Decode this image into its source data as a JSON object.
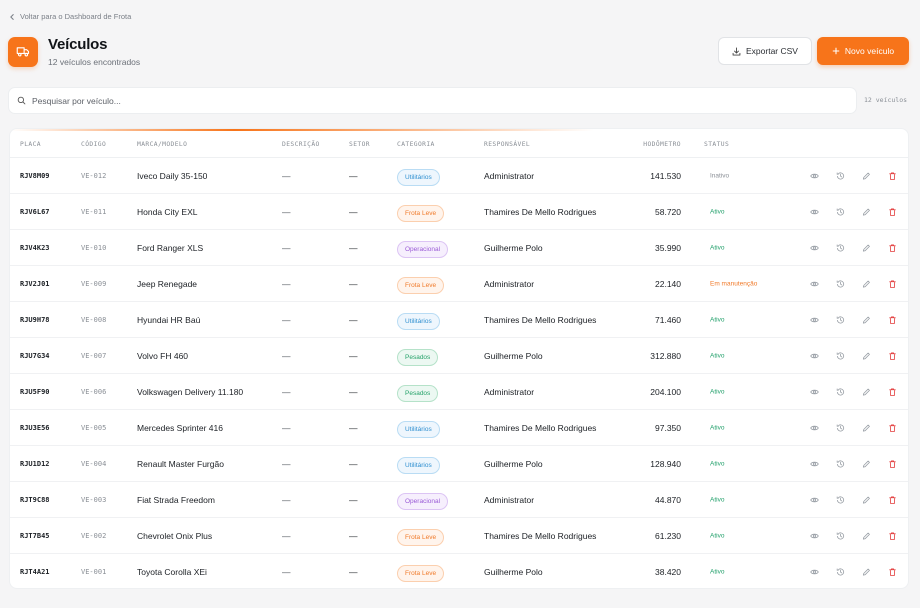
{
  "nav": {
    "back_label": "Voltar para o Dashboard de Frota"
  },
  "header": {
    "title": "Veículos",
    "subtitle": "12 veículos encontrados",
    "export_label": "Exportar CSV",
    "new_label": "Novo veículo"
  },
  "search": {
    "placeholder": "Pesquisar por veículo...",
    "value": "",
    "count_label": "12 veículos"
  },
  "colors": {
    "accent": "#f7741a"
  },
  "table": {
    "columns": [
      "Placa",
      "Código",
      "Marca/Modelo",
      "Descrição",
      "Setor",
      "Categoria",
      "Responsável",
      "Hodômetro",
      "Status"
    ],
    "rows": [
      {
        "placa": "RJV8M09",
        "codigo": "VE-012",
        "marca": "Iveco Daily 35-150",
        "descricao": "—",
        "setor": "—",
        "categoria": "Utilitários",
        "responsavel": "Administrator",
        "hodometro": "141.530",
        "status": "Inativo"
      },
      {
        "placa": "RJV6L67",
        "codigo": "VE-011",
        "marca": "Honda City EXL",
        "descricao": "—",
        "setor": "—",
        "categoria": "Frota Leve",
        "responsavel": "Thamires De Mello Rodrigues",
        "hodometro": "58.720",
        "status": "Ativo"
      },
      {
        "placa": "RJV4K23",
        "codigo": "VE-010",
        "marca": "Ford Ranger XLS",
        "descricao": "—",
        "setor": "—",
        "categoria": "Operacional",
        "responsavel": "Guilherme Polo",
        "hodometro": "35.990",
        "status": "Ativo"
      },
      {
        "placa": "RJV2J01",
        "codigo": "VE-009",
        "marca": "Jeep Renegade",
        "descricao": "—",
        "setor": "—",
        "categoria": "Frota Leve",
        "responsavel": "Administrator",
        "hodometro": "22.140",
        "status": "Em manutenção"
      },
      {
        "placa": "RJU9H78",
        "codigo": "VE-008",
        "marca": "Hyundai HR Baú",
        "descricao": "—",
        "setor": "—",
        "categoria": "Utilitários",
        "responsavel": "Thamires De Mello Rodrigues",
        "hodometro": "71.460",
        "status": "Ativo"
      },
      {
        "placa": "RJU7G34",
        "codigo": "VE-007",
        "marca": "Volvo FH 460",
        "descricao": "—",
        "setor": "—",
        "categoria": "Pesados",
        "responsavel": "Guilherme Polo",
        "hodometro": "312.880",
        "status": "Ativo"
      },
      {
        "placa": "RJU5F90",
        "codigo": "VE-006",
        "marca": "Volkswagen Delivery 11.180",
        "descricao": "—",
        "setor": "—",
        "categoria": "Pesados",
        "responsavel": "Administrator",
        "hodometro": "204.100",
        "status": "Ativo"
      },
      {
        "placa": "RJU3E56",
        "codigo": "VE-005",
        "marca": "Mercedes Sprinter 416",
        "descricao": "—",
        "setor": "—",
        "categoria": "Utilitários",
        "responsavel": "Thamires De Mello Rodrigues",
        "hodometro": "97.350",
        "status": "Ativo"
      },
      {
        "placa": "RJU1D12",
        "codigo": "VE-004",
        "marca": "Renault Master Furgão",
        "descricao": "—",
        "setor": "—",
        "categoria": "Utilitários",
        "responsavel": "Guilherme Polo",
        "hodometro": "128.940",
        "status": "Ativo"
      },
      {
        "placa": "RJT9C88",
        "codigo": "VE-003",
        "marca": "Fiat Strada Freedom",
        "descricao": "—",
        "setor": "—",
        "categoria": "Operacional",
        "responsavel": "Administrator",
        "hodometro": "44.870",
        "status": "Ativo"
      },
      {
        "placa": "RJT7B45",
        "codigo": "VE-002",
        "marca": "Chevrolet Onix Plus",
        "descricao": "—",
        "setor": "—",
        "categoria": "Frota Leve",
        "responsavel": "Thamires De Mello Rodrigues",
        "hodometro": "61.230",
        "status": "Ativo"
      },
      {
        "placa": "RJT4A21",
        "codigo": "VE-001",
        "marca": "Toyota Corolla XEi",
        "descricao": "—",
        "setor": "—",
        "categoria": "Frota Leve",
        "responsavel": "Guilherme Polo",
        "hodometro": "38.420",
        "status": "Ativo"
      }
    ],
    "row_actions": [
      "eye-icon",
      "history-icon",
      "pencil-icon",
      "trash-icon"
    ]
  },
  "category_styles": {
    "Utilitários": {
      "color": "#2f8fd0",
      "bg": "#eef6fd",
      "border": "#b9dcf4"
    },
    "Frota Leve": {
      "color": "#f07a2a",
      "bg": "#fff4ec",
      "border": "#fbcfae"
    },
    "Operacional": {
      "color": "#9a5bd6",
      "bg": "#f6effd",
      "border": "#dcc4f4"
    },
    "Pesados": {
      "color": "#26a36a",
      "bg": "#ecf8f2",
      "border": "#b5e2c9"
    }
  },
  "status_colors": {
    "Ativo": "#22a06b",
    "Inativo": "#8a8f96",
    "Em manutenção": "#f07a2a"
  }
}
